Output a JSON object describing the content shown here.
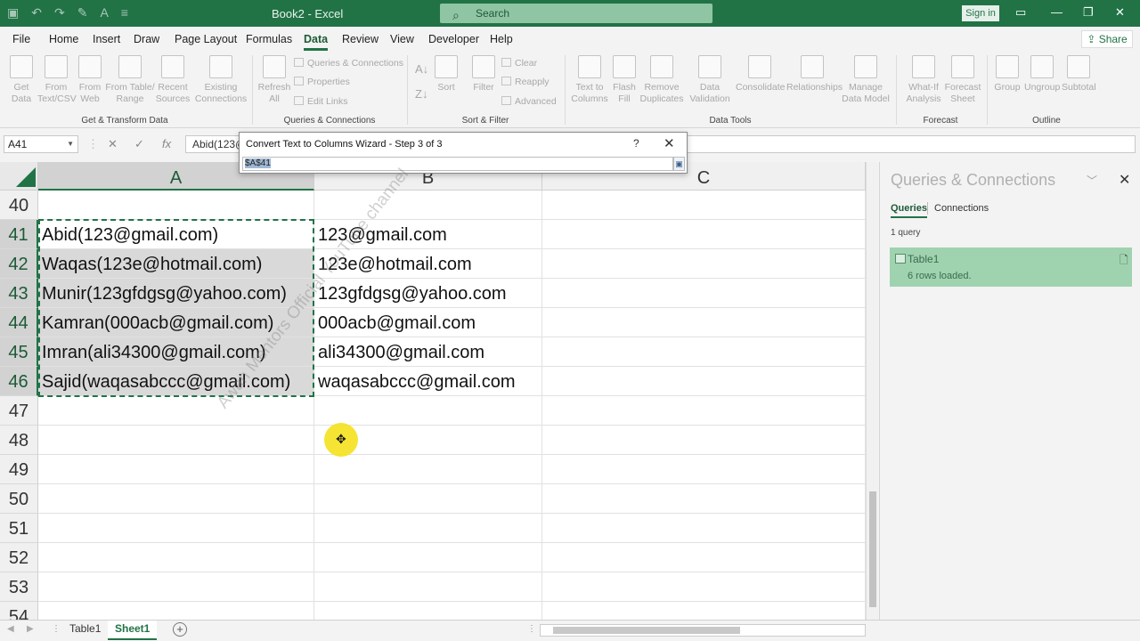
{
  "app": {
    "title": "Book2 - Excel",
    "search_placeholder": "Search",
    "signin": "Sign in",
    "share": "Share"
  },
  "tabs": [
    "File",
    "Home",
    "Insert",
    "Draw",
    "Page Layout",
    "Formulas",
    "Data",
    "Review",
    "View",
    "Developer",
    "Help"
  ],
  "active_tab": "Data",
  "ribbon": {
    "get_data": "Get Data",
    "from_text": "From Text/CSV",
    "from_web": "From Web",
    "from_table": "From Table/ Range",
    "recent_sources": "Recent Sources",
    "existing_connections": "Existing Connections",
    "group_get_transform": "Get & Transform Data",
    "refresh_all": "Refresh All",
    "queries_connections": "Queries & Connections",
    "properties": "Properties",
    "edit_links": "Edit Links",
    "group_queries": "Queries & Connections",
    "sort": "Sort",
    "filter": "Filter",
    "clear": "Clear",
    "reapply": "Reapply",
    "advanced": "Advanced",
    "group_sort_filter": "Sort & Filter",
    "text_to_columns": "Text to Columns",
    "flash_fill": "Flash Fill",
    "remove_duplicates": "Remove Duplicates",
    "data_validation": "Data Validation",
    "consolidate": "Consolidate",
    "relationships": "Relationships",
    "manage_data_model": "Manage Data Model",
    "group_data_tools": "Data Tools",
    "what_if": "What-If Analysis",
    "forecast_sheet": "Forecast Sheet",
    "group_forecast": "Forecast",
    "group": "Group",
    "ungroup": "Ungroup",
    "subtotal": "Subtotal",
    "group_outline": "Outline"
  },
  "formula_bar": {
    "name_box": "A41",
    "formula": "Abid(123@"
  },
  "dialog": {
    "title": "Convert Text to Columns Wizard - Step 3 of 3",
    "help": "?",
    "close": "✕",
    "range": "$A$41"
  },
  "columns": [
    "A",
    "B",
    "C"
  ],
  "rows": [
    {
      "num": "40",
      "a": "",
      "b": ""
    },
    {
      "num": "41",
      "a": "Abid(123@gmail.com)",
      "b": "123@gmail.com"
    },
    {
      "num": "42",
      "a": "Waqas(123e@hotmail.com)",
      "b": "123e@hotmail.com"
    },
    {
      "num": "43",
      "a": "Munir(123gfdgsg@yahoo.com)",
      "b": "123gfdgsg@yahoo.com"
    },
    {
      "num": "44",
      "a": "Kamran(000acb@gmail.com)",
      "b": "000acb@gmail.com"
    },
    {
      "num": "45",
      "a": "Imran(ali34300@gmail.com)",
      "b": "ali34300@gmail.com"
    },
    {
      "num": "46",
      "a": "Sajid(waqasabccc@gmail.com)",
      "b": "waqasabccc@gmail.com"
    },
    {
      "num": "47",
      "a": "",
      "b": ""
    },
    {
      "num": "48",
      "a": "",
      "b": ""
    },
    {
      "num": "49",
      "a": "",
      "b": ""
    },
    {
      "num": "50",
      "a": "",
      "b": ""
    },
    {
      "num": "51",
      "a": "",
      "b": ""
    },
    {
      "num": "52",
      "a": "",
      "b": ""
    },
    {
      "num": "53",
      "a": "",
      "b": ""
    },
    {
      "num": "54",
      "a": "",
      "b": ""
    }
  ],
  "pane": {
    "title": "Queries & Connections",
    "tab_queries": "Queries",
    "tab_connections": "Connections",
    "count": "1 query",
    "query_name": "Table1",
    "query_status": "6 rows loaded."
  },
  "sheets": [
    "Table1",
    "Sheet1"
  ],
  "active_sheet": "Sheet1",
  "watermark": "Awan Mentors Official YouTube channel",
  "colors": {
    "accent": "#217346",
    "selection": "#d9d9d9",
    "query_card": "#9fd3b0",
    "cursor_highlight": "#f5e21d"
  }
}
